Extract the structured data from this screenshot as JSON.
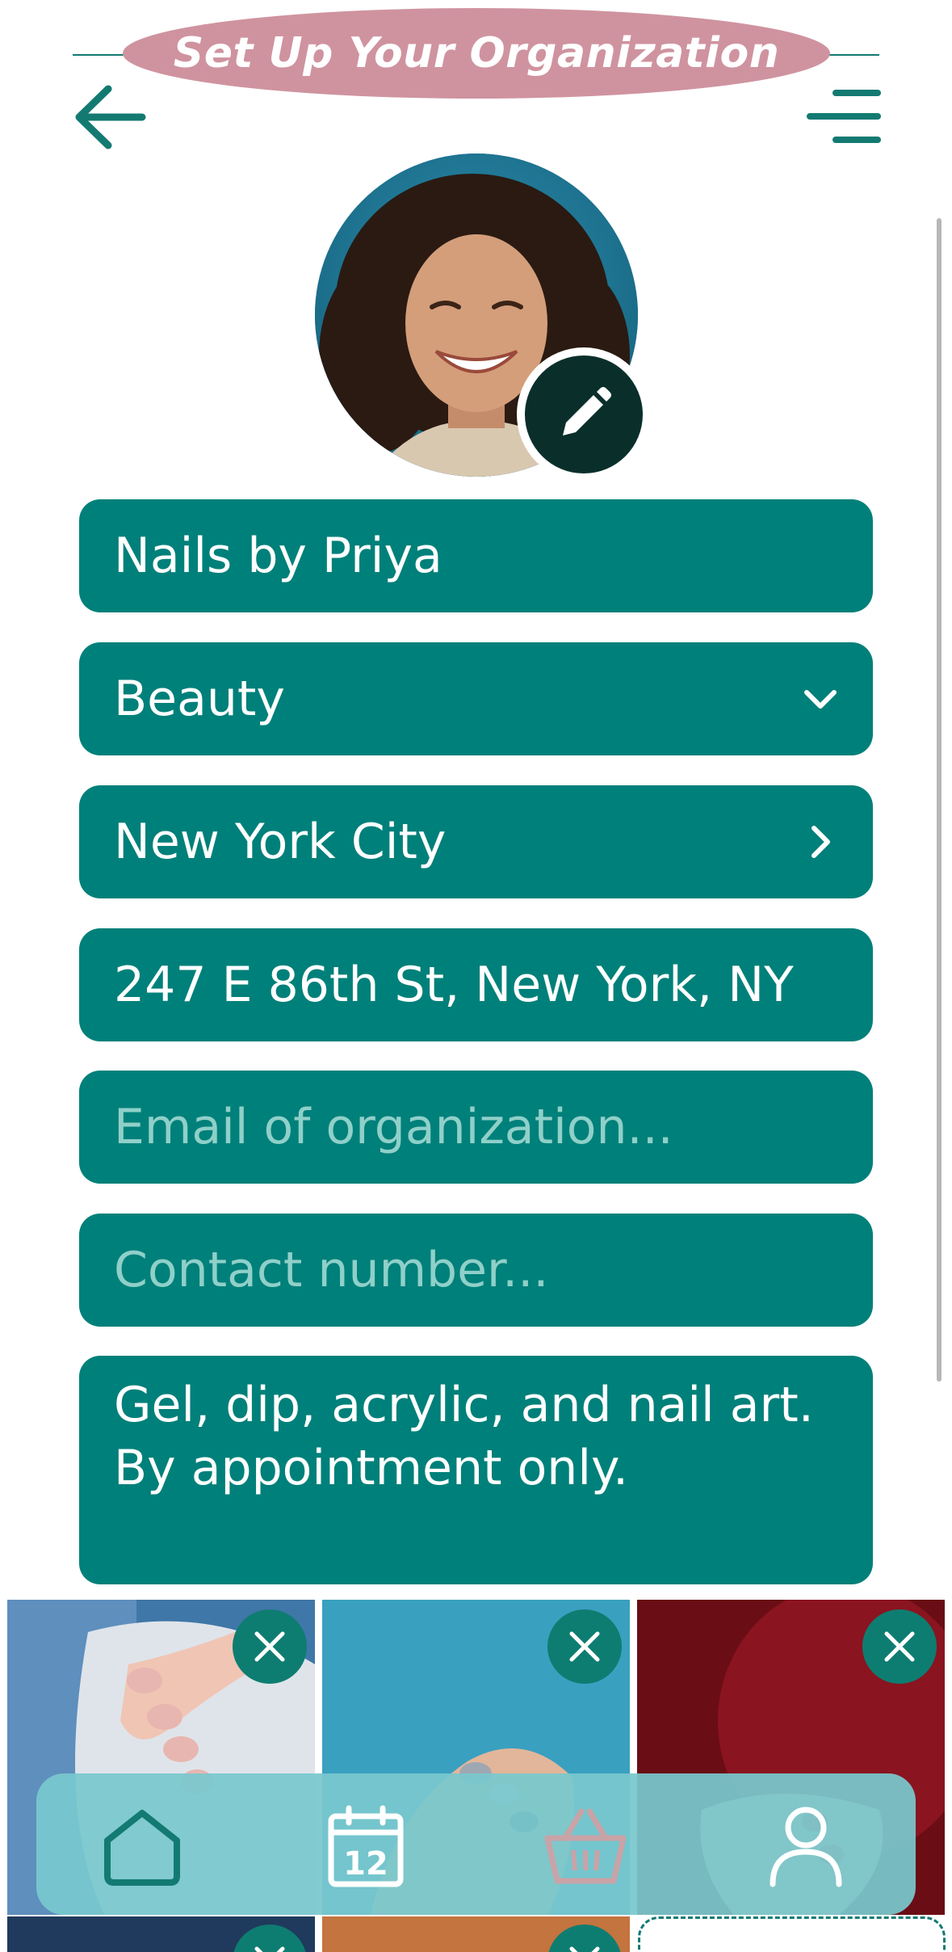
{
  "header": {
    "title": "Set Up Your Organization",
    "back_icon": "arrow-left-icon",
    "menu_icon": "menu-icon"
  },
  "profile": {
    "edit_icon": "pencil-icon"
  },
  "form": {
    "name_value": "Nails by Priya",
    "category_value": "Beauty",
    "city_value": "New York City",
    "address_value": "247 E 86th St, New York, NY",
    "email_placeholder": "Email of organization...",
    "phone_placeholder": "Contact number...",
    "description_value": "Gel, dip, acrylic, and nail art. By appointment only."
  },
  "gallery": {
    "remove_icon": "close-icon"
  },
  "bottom_nav": {
    "items": [
      "home-icon",
      "calendar-icon",
      "basket-icon",
      "profile-icon"
    ],
    "calendar_day": "12",
    "active_index": 3
  },
  "colors": {
    "accent": "#00807a",
    "title_pill": "#cf939f",
    "nav_bg": "#78c8cd"
  }
}
